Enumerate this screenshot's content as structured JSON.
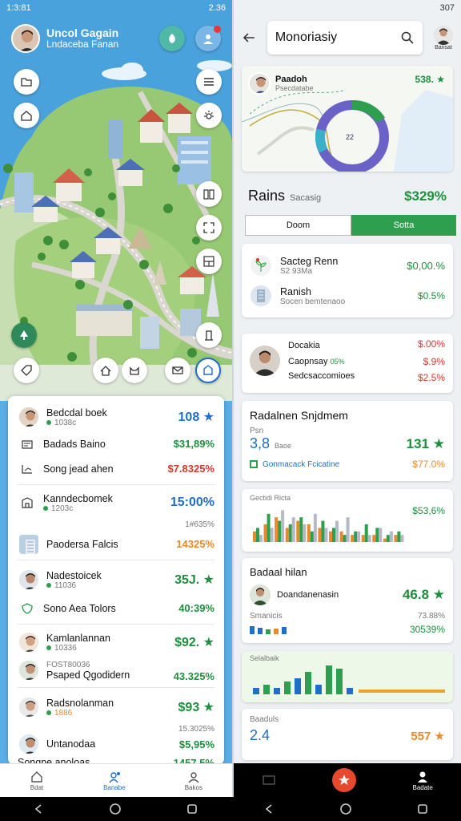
{
  "left": {
    "status": {
      "time": "1:3:81",
      "right": "2.36"
    },
    "header": {
      "title": "Uncol Gagain",
      "subtitle": "Lndaceba Fanan"
    },
    "list": [
      {
        "name": "Bedcdal boek",
        "sub": "1038c",
        "value": "108 ★",
        "color": "#1f6fc9"
      },
      {
        "name": "Badads Baino",
        "value": "$31,89%",
        "color": "#1e8f3c"
      },
      {
        "name": "Song jead ahen",
        "value": "$7.8325%",
        "color": "#d03a2a"
      },
      {
        "name": "Kanndecbomek",
        "sub": "1203c",
        "value": "15:00%",
        "color": "#1f6fc9"
      },
      {
        "name": "",
        "value": "1#635%",
        "color": "#777"
      },
      {
        "name": "Paodersa Falcis",
        "value": "14325%",
        "color": "#e8892d"
      },
      {
        "name": "Nadestoicek",
        "sub": "11036",
        "value": "35J. ★",
        "color": "#1e8f3c"
      },
      {
        "name": "Sono Aea Tolors",
        "value": "40:39%",
        "color": "#1e8f3c"
      },
      {
        "name": "Kamlanlannan",
        "sub": "10336",
        "value": "$92. ★",
        "color": "#1e8f3c"
      },
      {
        "name": "FOST80036",
        "value": "",
        "color": "#777"
      },
      {
        "name": "Psaped Qgodidern",
        "value": "43.325%",
        "color": "#1e8f3c"
      },
      {
        "name": "Radsnolanman",
        "sub": "1886",
        "value": "$93 ★",
        "color": "#1e8f3c"
      },
      {
        "name": "",
        "value": "15.3025%",
        "color": "#777"
      },
      {
        "name": "Untanodaa",
        "value": "$5,95%",
        "color": "#1e8f3c"
      },
      {
        "name": "Songne anoloas",
        "value": "1457.5%",
        "color": "#1e8f3c"
      }
    ],
    "nav": [
      "Bdat",
      "Banabe",
      "Bakos"
    ]
  },
  "right": {
    "status": {
      "time": "307"
    },
    "search": {
      "value": "Monoriasiy"
    },
    "avatar_label": "Bansat",
    "card1": {
      "name": "Paadoh",
      "sub": "Psecdatabe",
      "value": "538. ★",
      "center": "22"
    },
    "rains": {
      "title": "Rains",
      "sub": "Sacasig",
      "value": "$329%"
    },
    "tabs": {
      "left": "Doom",
      "right": "Sotta"
    },
    "c2": [
      {
        "name": "Sacteg Renn",
        "sub": "S2 93Ma",
        "value": "$0,00.%",
        "color": "#1e8f3c"
      },
      {
        "name": "Ranish",
        "sub": "Socen bemtenaoo",
        "value": "$0.5%",
        "color": "#1e8f3c"
      }
    ],
    "c3": [
      {
        "name": "Docakia",
        "value": "$.00%",
        "color": "#d03a2a"
      },
      {
        "name": "Caopnsay",
        "sub": "05%",
        "value": "$.9%",
        "color": "#d03a2a"
      },
      {
        "name": "Sedcsaccomioes",
        "value": "$2.5%",
        "color": "#d03a2a"
      }
    ],
    "c4": {
      "title": "Radalnen Snjdmem",
      "sub1": "Psn",
      "big": "3,8",
      "sub2": "Baoe",
      "value": "131 ★",
      "link": "Gonmacack Fcicatine",
      "link_value": "$77.0%"
    },
    "chart1": {
      "label": "Gectidi Ricta",
      "value": "$53,6%"
    },
    "c5": {
      "title": "Badaal hilan",
      "name": "Doandanenasin",
      "value": "46.8 ★",
      "row2": "Smanicis",
      "row2_right": "73.88%",
      "row3": "30539%"
    },
    "chart2": {
      "label": "Selalbaik"
    },
    "c6": {
      "label": "Baaduls",
      "big": "2.4",
      "value": "557 ★"
    },
    "nav": [
      "",
      "",
      "Badate"
    ]
  },
  "chart_data": [
    {
      "type": "bar",
      "title": "Gectidi Ricta",
      "series": [
        {
          "color": "#e8892d",
          "values": [
            3,
            5,
            7,
            4,
            6,
            5,
            4,
            3,
            3,
            2,
            2,
            2,
            1,
            2
          ]
        },
        {
          "color": "#2e9e4f",
          "values": [
            4,
            8,
            6,
            5,
            7,
            3,
            6,
            4,
            2,
            3,
            5,
            4,
            2,
            3
          ]
        },
        {
          "color": "#b5b9c6",
          "values": [
            2,
            4,
            9,
            7,
            5,
            8,
            4,
            6,
            7,
            3,
            2,
            4,
            3,
            2
          ]
        }
      ],
      "legend": [
        {
          "color": "#e8892d"
        },
        {
          "color": "#2e9e4f"
        },
        {
          "color": "#b5b9c6"
        }
      ]
    },
    {
      "type": "bar",
      "title": "Selalbaik",
      "values": [
        2,
        3,
        2,
        4,
        5,
        7,
        3,
        9,
        8,
        2
      ],
      "colors": [
        "#1f6fc9",
        "#2e9e4f",
        "#1f6fc9",
        "#2e9e4f",
        "#1f6fc9",
        "#2e9e4f",
        "#1f6fc9",
        "#2e9e4f",
        "#2e9e4f",
        "#1f6fc9"
      ]
    }
  ]
}
